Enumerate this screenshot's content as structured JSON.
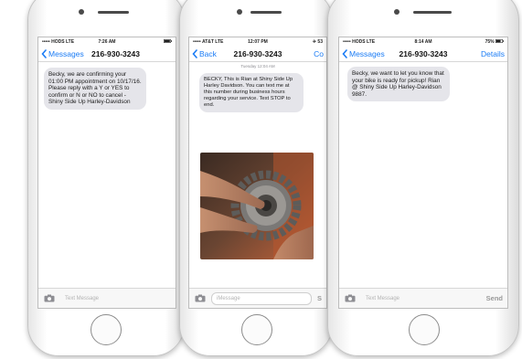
{
  "phone1": {
    "status": {
      "carrier": "••••• HODS  LTE",
      "time": "7:26 AM",
      "battery": ""
    },
    "nav": {
      "back_label": "Messages",
      "title": "216-930-3243",
      "right": ""
    },
    "message": "Becky, we are confirming your 01:00 PM appointment on 10/17/16. Please reply with a Y or YES to confirm or N or NO to cancel - Shiny Side Up Harley-Davidson",
    "input": {
      "placeholder": "Text Message",
      "send": ""
    }
  },
  "phone2": {
    "status": {
      "carrier": "••••• AT&T  LTE",
      "time": "12:07 PM",
      "battery": "✈ 53"
    },
    "nav": {
      "back_label": "Back",
      "title": "216-930-3243",
      "right": "Co"
    },
    "timestamp": "Tuesday 12:04 AM",
    "message": "BECKY, This is Rian at Shiny Side Up Harley Davidson. You can text me at this number during business hours regarding your service. Text STOP to end.",
    "photo_desc": "gear-photo",
    "input": {
      "placeholder": "iMessage",
      "send": "S"
    }
  },
  "phone3": {
    "status": {
      "carrier": "••••• HODS  LTE",
      "time": "8:14 AM",
      "battery": "75%"
    },
    "nav": {
      "back_label": "Messages",
      "title": "216-930-3243",
      "right": "Details"
    },
    "message": "Becky, we want to let you know that your bike is ready for pickup! Rian @ Shiny Side Up Harley-Davidson 9887.",
    "input": {
      "placeholder": "Text Message",
      "send": "Send"
    }
  },
  "colors": {
    "accent": "#1b7cf5",
    "bubble": "#e5e5ea"
  },
  "icons": [
    "chevron-left-icon",
    "camera-icon",
    "battery-icon"
  ]
}
